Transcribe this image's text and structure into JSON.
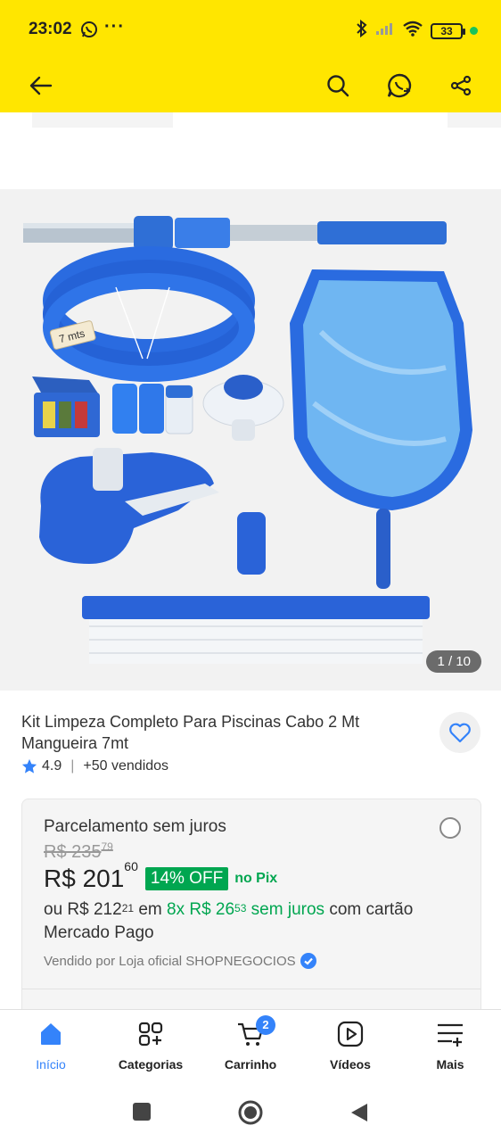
{
  "status_bar": {
    "time": "23:02",
    "battery": "33"
  },
  "gallery": {
    "counter": "1 / 10",
    "hose_tag": "7 mts"
  },
  "product": {
    "title": "Kit Limpeza Completo Para Piscinas Cabo 2 Mt Mangueira 7mt",
    "rating": "4.9",
    "sold": "+50 vendidos"
  },
  "payment": {
    "header": "Parcelamento sem juros",
    "old_price_main": "R$ 235",
    "old_price_cents": "79",
    "price_main": "R$ 201",
    "price_cents": "60",
    "discount": "14% OFF",
    "pix": "no Pix",
    "install_prefix": "ou R$ 212",
    "install_prefix_cents": "21",
    "install_mid": " em ",
    "install_green": "8x R$ 26",
    "install_green_cents": "53",
    "install_green2": " sem juros",
    "install_suffix": " com cartão Mercado Pago",
    "seller": "Vendido por Loja oficial SHOPNEGOCIOS"
  },
  "bottom_nav": [
    {
      "label": "Início",
      "icon": "home-icon",
      "active": true
    },
    {
      "label": "Categorias",
      "icon": "categories-icon"
    },
    {
      "label": "Carrinho",
      "icon": "cart-icon",
      "badge": "2"
    },
    {
      "label": "Vídeos",
      "icon": "video-icon"
    },
    {
      "label": "Mais",
      "icon": "menu-plus-icon"
    }
  ],
  "colors": {
    "header": "#ffe600",
    "accent": "#3483fa",
    "green": "#00a650"
  }
}
